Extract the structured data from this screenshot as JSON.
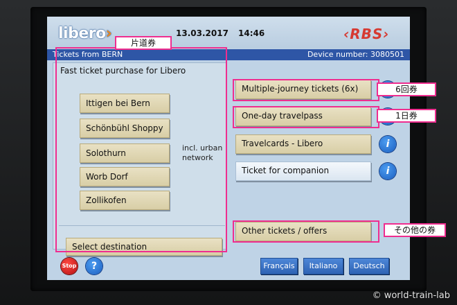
{
  "header": {
    "logo": {
      "text": "libero",
      "accent": "›"
    },
    "date": "13.03.2017",
    "time": "14:46",
    "brand_right": "‹RBS›"
  },
  "infobar": {
    "left": "Tickets from BERN",
    "right": "Device number: 3080501"
  },
  "fast_panel": {
    "title": "Fast ticket purchase for Libero",
    "destinations": [
      "Ittigen bei Bern",
      "Schönbühl Shoppy",
      "Solothurn",
      "Worb Dorf",
      "Zollikofen"
    ],
    "note_line1": "incl. urban",
    "note_line2": "network",
    "select_label": "Select destination"
  },
  "right_menu": {
    "multi": "Multiple-journey tickets (6x)",
    "oneday": "One-day travelpass",
    "travelcards": "Travelcards - Libero",
    "companion": "Ticket for companion",
    "other": "Other tickets / offers"
  },
  "info_icon_text": "i",
  "bottom": {
    "stop": "Stop",
    "help": "?",
    "languages": [
      "Français",
      "Italiano",
      "Deutsch"
    ]
  },
  "annotations": {
    "single": "片道券",
    "six": "6回券",
    "day": "1日券",
    "other": "その他の券"
  },
  "watermark": "© world-train-lab",
  "colors": {
    "accent_blue": "#2e56a6",
    "highlight": "#ef2d8f",
    "button_beige": "#ddd3ad",
    "stop_red": "#d4201f"
  }
}
